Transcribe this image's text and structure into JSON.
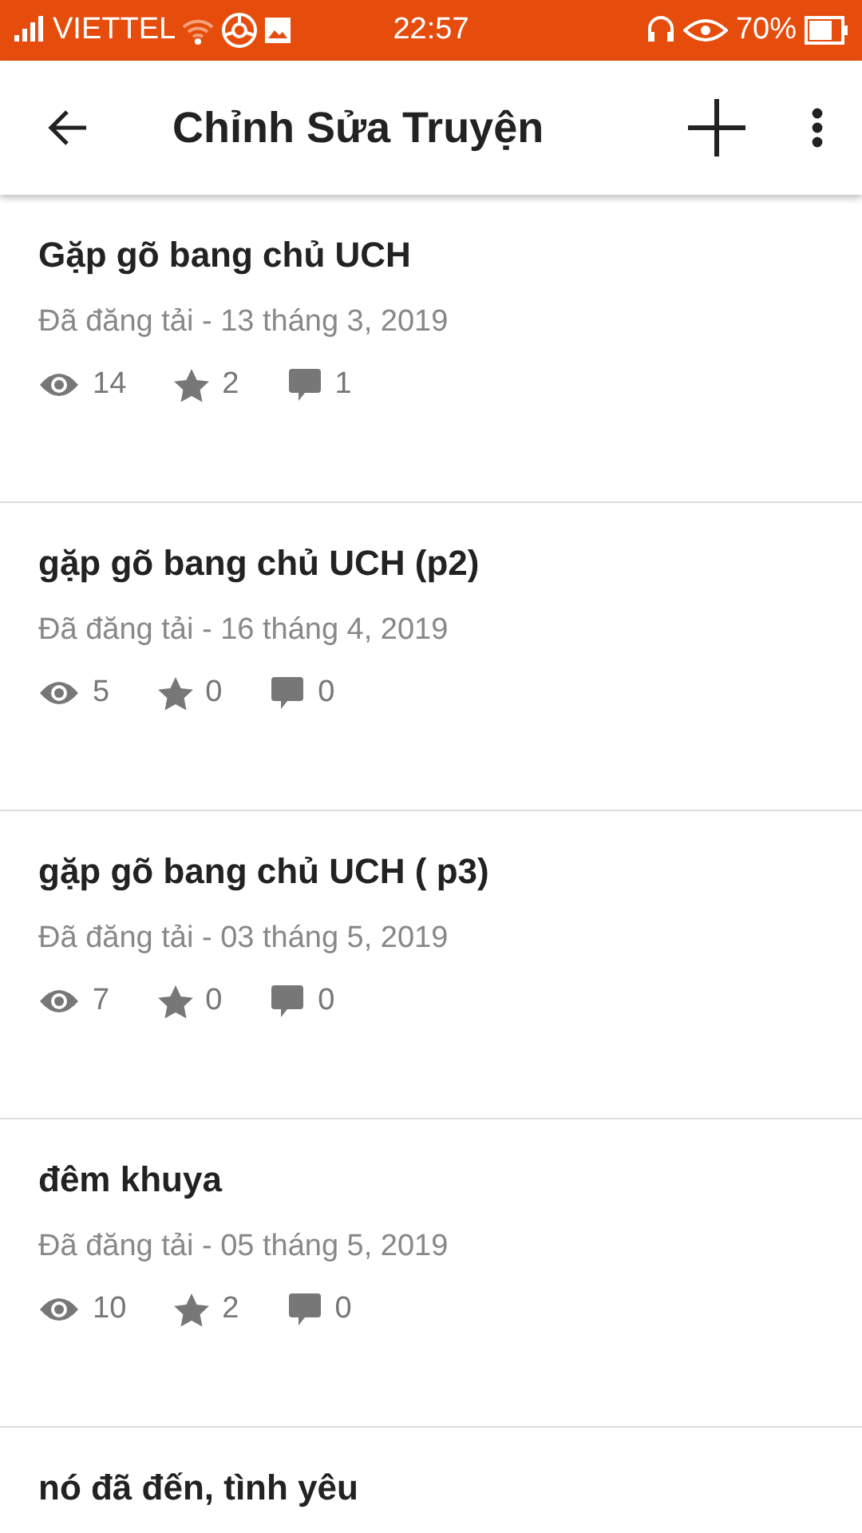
{
  "status_bar": {
    "carrier": "VIETTEL",
    "time": "22:57",
    "battery": "70%"
  },
  "app_bar": {
    "title": "Chỉnh Sửa Truyện"
  },
  "stories": [
    {
      "title": "Gặp gõ bang chủ UCH",
      "published": "Đã đăng tải - 13 tháng 3, 2019",
      "views": "14",
      "votes": "2",
      "comments": "1"
    },
    {
      "title": "gặp gõ bang chủ UCH (p2)",
      "published": "Đã đăng tải - 16 tháng 4, 2019",
      "views": "5",
      "votes": "0",
      "comments": "0"
    },
    {
      "title": "gặp gõ bang chủ UCH ( p3)",
      "published": "Đã đăng tải - 03 tháng 5, 2019",
      "views": "7",
      "votes": "0",
      "comments": "0"
    },
    {
      "title": "đêm khuya",
      "published": "Đã đăng tải - 05 tháng 5, 2019",
      "views": "10",
      "votes": "2",
      "comments": "0"
    },
    {
      "title": "nó đã đến, tình yêu"
    }
  ]
}
